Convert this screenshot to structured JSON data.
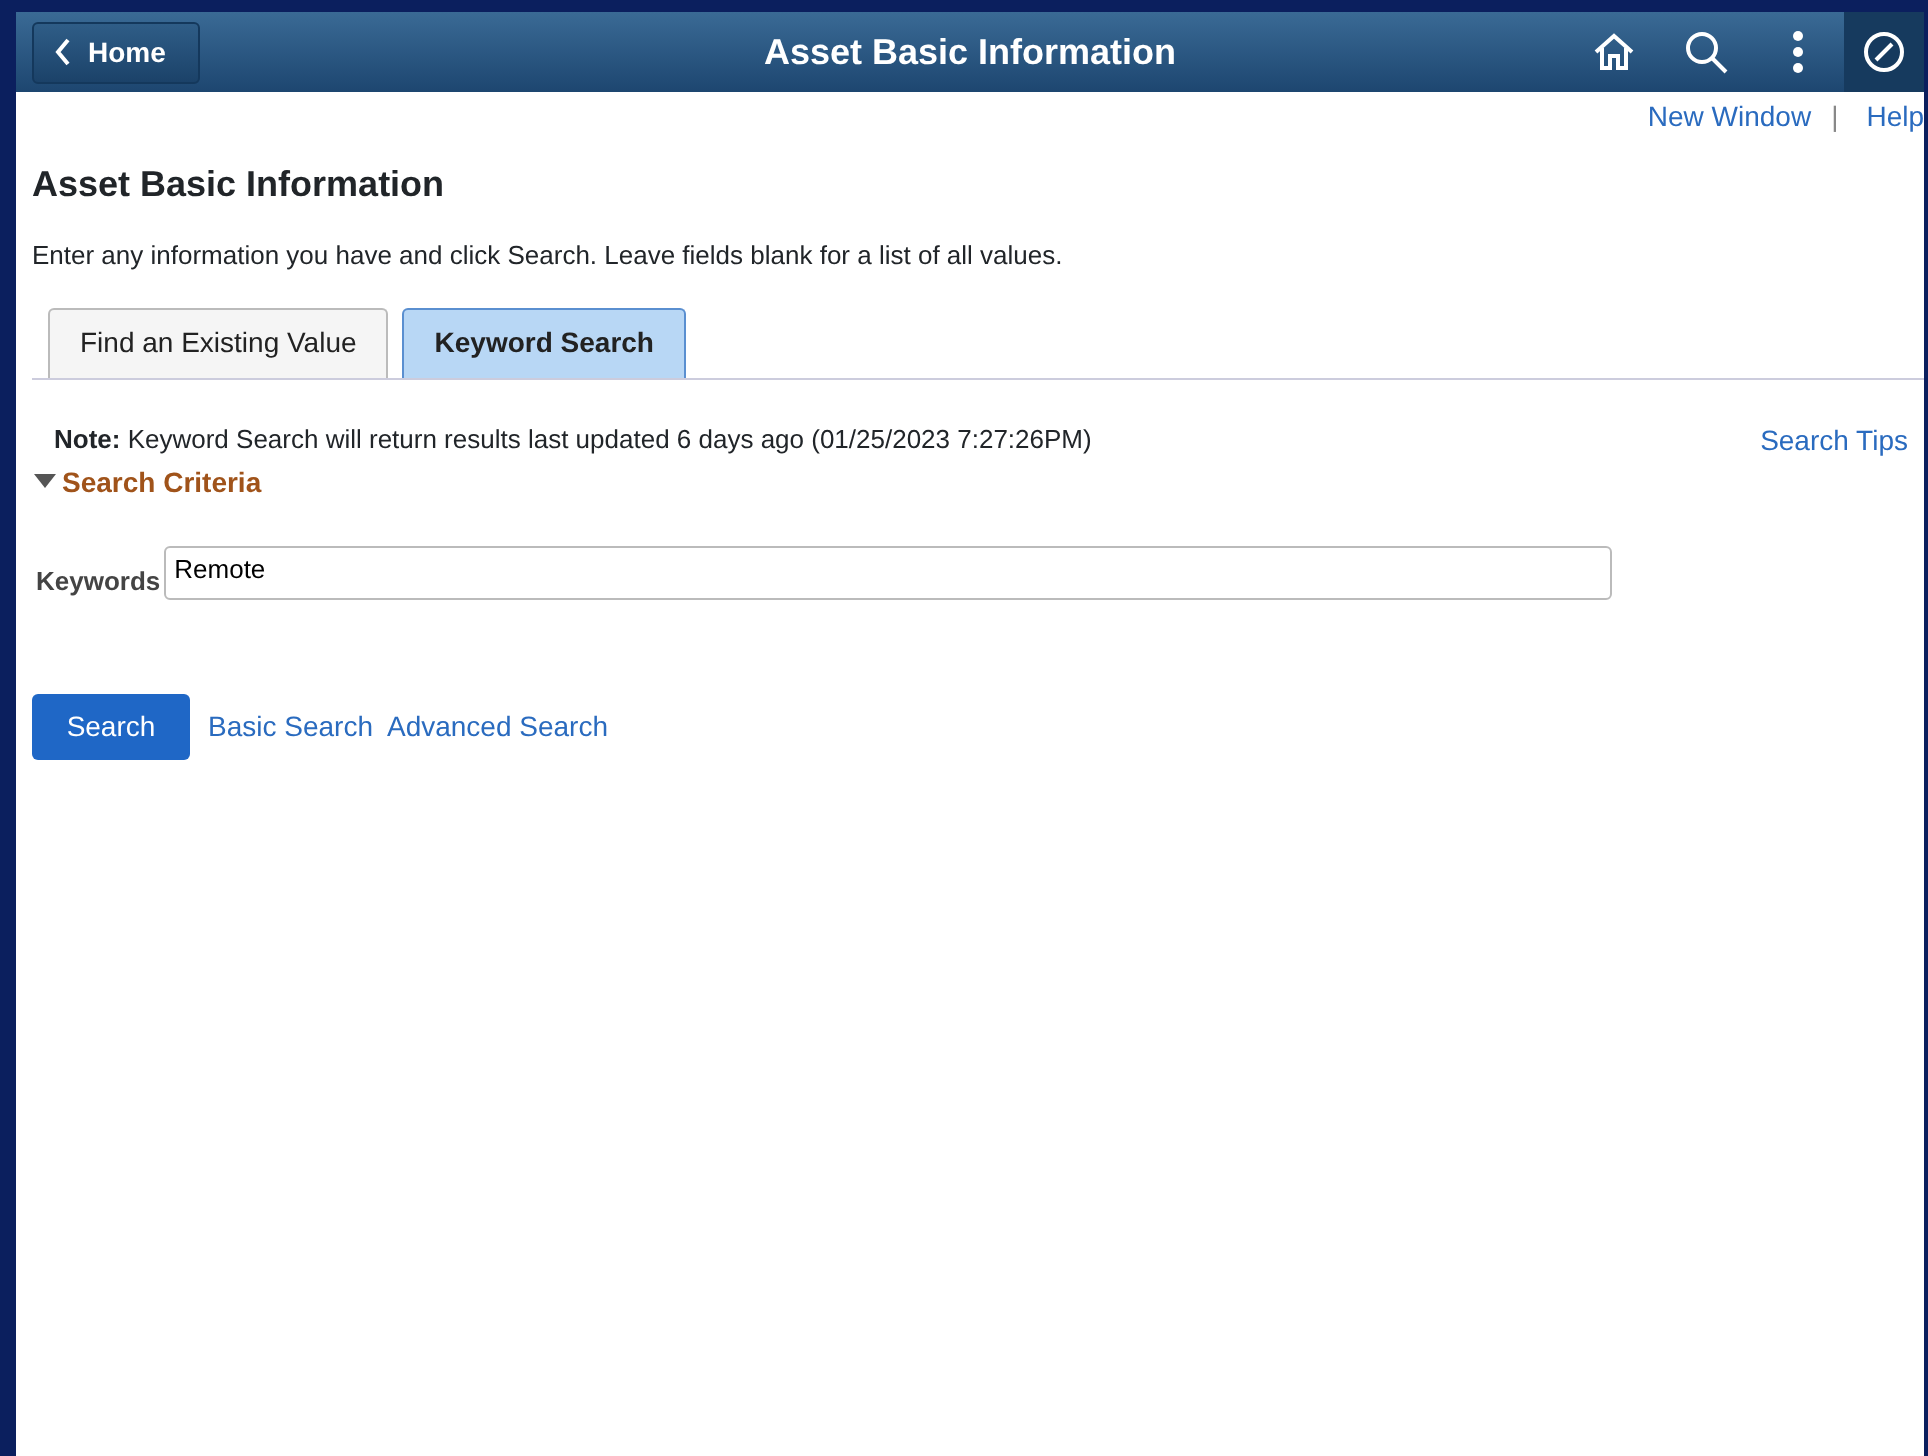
{
  "header": {
    "back_button": "Home",
    "title": "Asset Basic Information"
  },
  "top_links": [
    "New Window",
    "Help"
  ],
  "top_links_separator": "|",
  "page_title": "Asset Basic Information",
  "instructions": "Enter any information you have and click Search. Leave fields blank for a list of all values.",
  "tabs": [
    {
      "label": "Find an Existing Value",
      "selected": false
    },
    {
      "label": "Keyword Search",
      "selected": true
    }
  ],
  "note": "**Note:** Keyword Search will return results last updated 6 days ago (01/25/2023 7:27:26PM)",
  "search_tips": "Search Tips",
  "criteria": {
    "label": "Search Criteria",
    "expanded": true
  },
  "keywords": {
    "label": "Keywords",
    "value": "Remote"
  },
  "search_button": "Search",
  "links": [
    "Basic Search",
    "Advanced Search"
  ]
}
